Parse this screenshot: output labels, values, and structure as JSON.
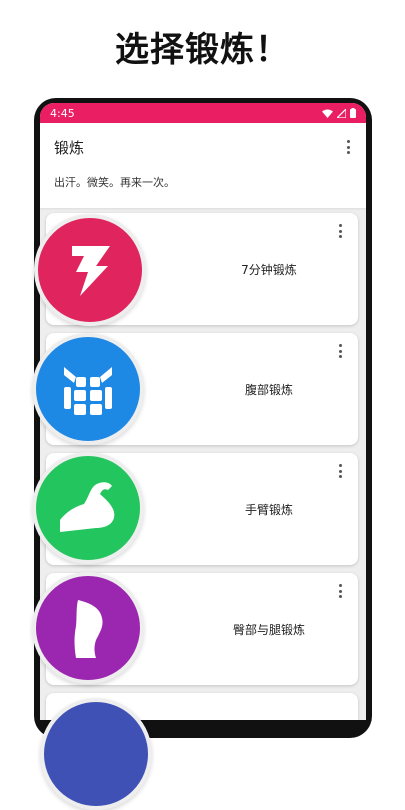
{
  "headline": "选择锻炼！",
  "status_bar": {
    "time": "4:45",
    "color": "#e91e63"
  },
  "header": {
    "title": "锻炼",
    "subtitle": "出汗。微笑。再来一次。"
  },
  "workouts": [
    {
      "label": "7分钟锻炼",
      "icon": "lightning-icon",
      "color": "#e0245e"
    },
    {
      "label": "腹部锻炼",
      "icon": "abs-icon",
      "color": "#1e88e5"
    },
    {
      "label": "手臂锻炼",
      "icon": "bicep-arm-icon",
      "color": "#22c55e"
    },
    {
      "label": "臀部与腿锻炼",
      "icon": "glutes-legs-icon",
      "color": "#9b27b0"
    }
  ]
}
